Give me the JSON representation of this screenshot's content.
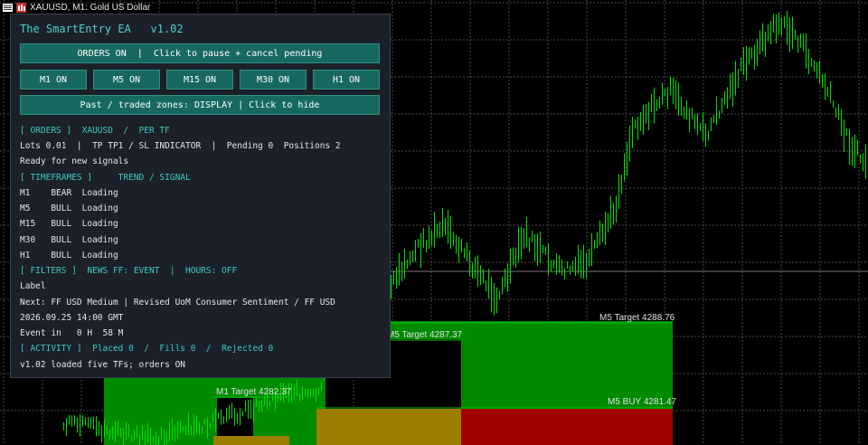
{
  "window": {
    "title": "XAUUSD, M1:  Gold US Dollar"
  },
  "panel": {
    "title": "The SmartEntry EA   v1.02",
    "orders_button": "ORDERS ON  |  Click to pause + cancel pending",
    "tf_buttons": [
      "M1 ON",
      "M5 ON",
      "M15 ON",
      "M30 ON",
      "H1 ON"
    ],
    "zones_button": "Past / traded zones: DISPLAY | Click to hide",
    "orders_header": "[ ORDERS ]  XAUUSD  /  PER TF",
    "lots_line": "Lots 0.01  |  TP TP1 / SL INDICATOR  |  Pending 0  Positions 2",
    "status_line": "Ready for new signals",
    "timeframes_header": "[ TIMEFRAMES ]     TREND / SIGNAL",
    "tf_rows": [
      "M1    BEAR  Loading",
      "M5    BULL  Loading",
      "M15   BULL  Loading",
      "M30   BULL  Loading",
      "H1    BULL  Loading"
    ],
    "filters_header": "[ FILTERS ]  NEWS FF: EVENT  |  HOURS: OFF",
    "label_line": "Label",
    "next_line": "Next: FF USD Medium | Revised UoM Consumer Sentiment / FF USD",
    "date_line": "2026.09.25 14:00 GMT",
    "event_line": "Event in   0 H  58 M",
    "activity_header": "[ ACTIVITY ]  Placed 0  /  Fills 0  /  Rejected 0",
    "log_line": "v1.02 loaded five TFs; orders ON"
  },
  "chart": {
    "zones": [
      {
        "label": "M5 Target 4288.76"
      },
      {
        "label": "M5 Target 4287.37"
      },
      {
        "label": "M1 Target 4282.37"
      },
      {
        "label": "M5 BUY 4281.47"
      }
    ],
    "colors": {
      "background": "#000000",
      "grid": "#4a4a4a",
      "candle": "#00e000",
      "target_zone": "#008a00",
      "buy_zone": "#a38200",
      "sell_zone": "#b00000"
    }
  }
}
